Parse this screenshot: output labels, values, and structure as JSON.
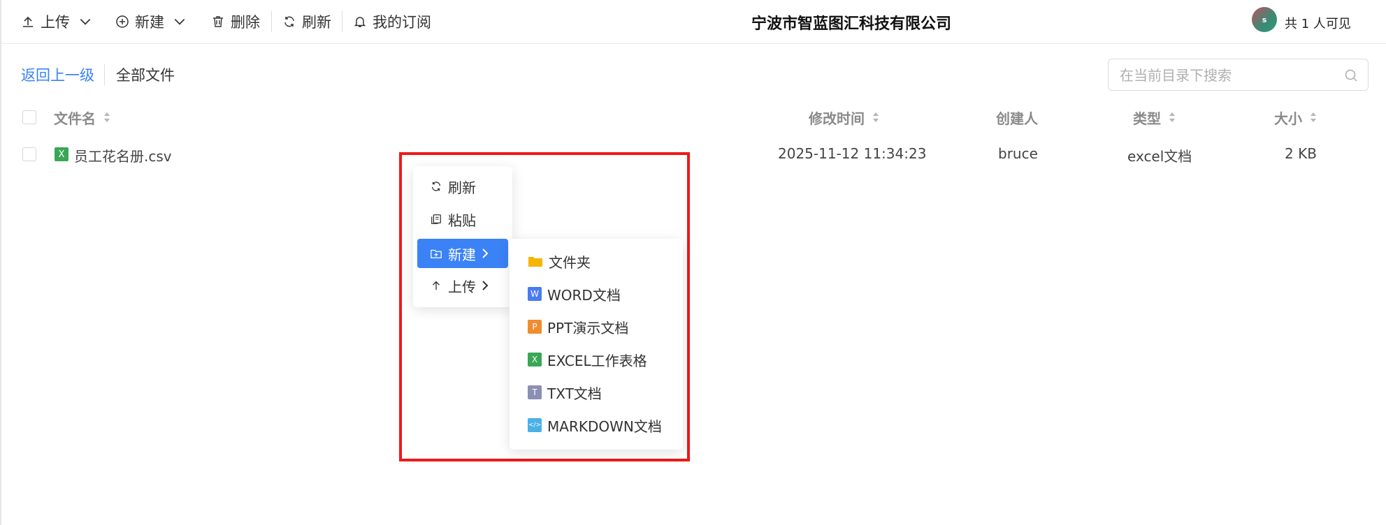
{
  "toolbar": {
    "upload_label": "上传",
    "new_label": "新建",
    "delete_label": "删除",
    "refresh_label": "刷新",
    "subscribe_label": "我的订阅",
    "company": "宁波市智蓝图汇科技有限公司",
    "avatar_initial": "s",
    "visibility": "共 1 人可见"
  },
  "path": {
    "back": "返回上一级",
    "current": "全部文件"
  },
  "search": {
    "placeholder": "在当前目录下搜索"
  },
  "table": {
    "headers": {
      "name": "文件名",
      "modified": "修改时间",
      "creator": "创建人",
      "type": "类型",
      "size": "大小"
    },
    "rows": [
      {
        "icon": "excel-icon",
        "icon_letter": "X",
        "name": "员工花名册.csv",
        "modified": "2025-11-12 11:34:23",
        "creator": "bruce",
        "type": "excel文档",
        "size": "2 KB"
      }
    ]
  },
  "context_menu": {
    "items": [
      {
        "label": "刷新",
        "icon": "refresh-icon"
      },
      {
        "label": "粘贴",
        "icon": "paste-icon"
      },
      {
        "label": "新建",
        "icon": "new-folder-icon",
        "active": true,
        "has_submenu": true
      },
      {
        "label": "上传",
        "icon": "upload-icon",
        "has_submenu": true
      }
    ],
    "submenu": [
      {
        "label": "文件夹",
        "icon": "folder-icon",
        "color": "#f7b500",
        "letter": ""
      },
      {
        "label": "WORD文档",
        "icon": "word-icon",
        "color": "#4a7cf0",
        "letter": "W"
      },
      {
        "label": "PPT演示文档",
        "icon": "ppt-icon",
        "color": "#f08c2e",
        "letter": "P"
      },
      {
        "label": "EXCEL工作表格",
        "icon": "excel-icon",
        "color": "#3aa757",
        "letter": "X"
      },
      {
        "label": "TXT文档",
        "icon": "txt-icon",
        "color": "#8a8fb3",
        "letter": "T"
      },
      {
        "label": "MARKDOWN文档",
        "icon": "markdown-icon",
        "color": "#4ab0e8",
        "letter": "</>"
      }
    ]
  },
  "colors": {
    "accent": "#3b82f6",
    "highlight": "#f01818"
  }
}
